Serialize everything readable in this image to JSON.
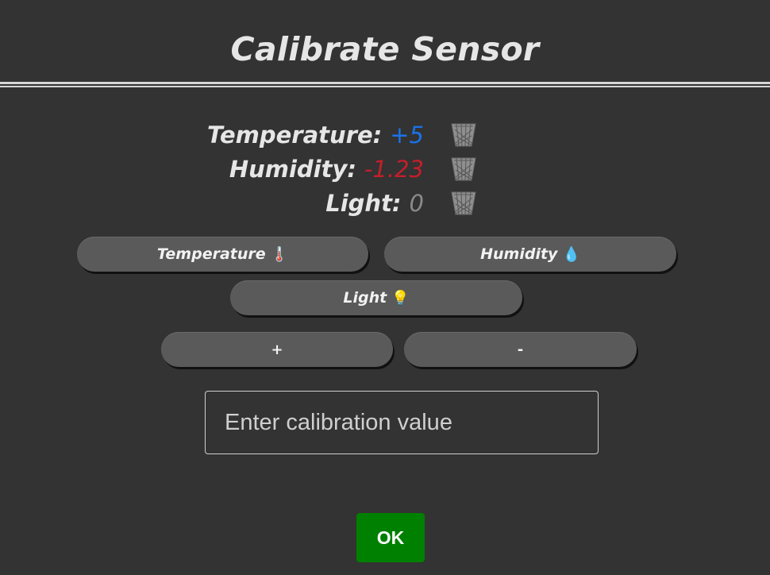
{
  "header": {
    "title": "Calibrate Sensor"
  },
  "readings": [
    {
      "label": "Temperature:",
      "value": "+5",
      "value_color": "#1a73e8",
      "delete_icon": "trash-can-icon"
    },
    {
      "label": "Humidity:",
      "value": "-1.23",
      "value_color": "#c41e2a",
      "delete_icon": "trash-can-icon"
    },
    {
      "label": "Light:",
      "value": "0",
      "value_color": "#8a8a8a",
      "delete_icon": "trash-can-icon"
    }
  ],
  "sensor_buttons": {
    "temperature": {
      "label": "Temperature",
      "emoji": "🌡️",
      "icon": "thermometer-icon"
    },
    "humidity": {
      "label": "Humidity",
      "emoji": "💧",
      "icon": "droplet-icon"
    },
    "light": {
      "label": "Light",
      "emoji": "💡",
      "icon": "light-bulb-icon"
    }
  },
  "adjust_buttons": {
    "plus_label": "+",
    "minus_label": "-"
  },
  "calibration_input": {
    "placeholder": "Enter calibration value",
    "value": ""
  },
  "ok_button": {
    "label": "OK",
    "color": "#008000"
  },
  "colors": {
    "background": "#333333",
    "button": "#5a5a5a"
  }
}
